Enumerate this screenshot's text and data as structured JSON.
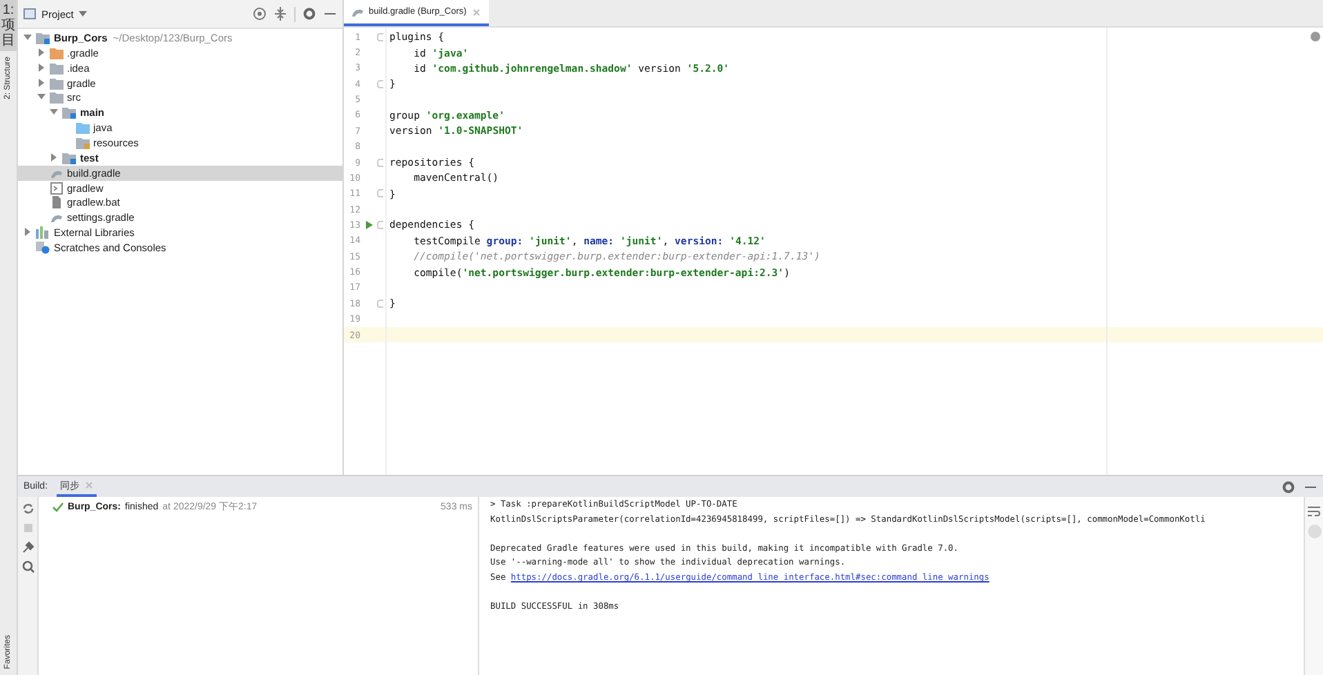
{
  "side_tabs": [
    {
      "label": "1: 项目",
      "kind": "stacked",
      "selected": true
    },
    {
      "label": "2: Structure",
      "kind": "rotated",
      "selected": false
    }
  ],
  "bottom_side_tabs": [
    {
      "label": "Favorites",
      "kind": "rotated",
      "selected": false
    }
  ],
  "project": {
    "title": "Project",
    "tree": [
      {
        "label": "Burp_Cors",
        "path": "~/Desktop/123/Burp_Cors",
        "kind": "module",
        "bold": true,
        "expanded": true,
        "selected": false,
        "children": [
          {
            "label": ".gradle",
            "kind": "folder-orange",
            "bold": false,
            "expanded": false,
            "selected": false
          },
          {
            "label": ".idea",
            "kind": "folder",
            "bold": false,
            "expanded": false,
            "selected": false
          },
          {
            "label": "gradle",
            "kind": "folder",
            "bold": false,
            "expanded": false,
            "selected": false
          },
          {
            "label": "src",
            "kind": "folder",
            "bold": false,
            "expanded": true,
            "selected": false,
            "children": [
              {
                "label": "main",
                "kind": "module-folder",
                "bold": true,
                "expanded": true,
                "selected": false,
                "children": [
                  {
                    "label": "java",
                    "kind": "source-folder",
                    "bold": false,
                    "selected": false
                  },
                  {
                    "label": "resources",
                    "kind": "resource-folder",
                    "bold": false,
                    "selected": false
                  }
                ]
              },
              {
                "label": "test",
                "kind": "module-folder",
                "bold": true,
                "expanded": false,
                "selected": false
              }
            ]
          },
          {
            "label": "build.gradle",
            "kind": "gradle-file",
            "bold": false,
            "selected": true
          },
          {
            "label": "gradlew",
            "kind": "script-file",
            "bold": false,
            "selected": false
          },
          {
            "label": "gradlew.bat",
            "kind": "bat-file",
            "bold": false,
            "selected": false
          },
          {
            "label": "settings.gradle",
            "kind": "gradle-file",
            "bold": false,
            "selected": false
          }
        ]
      },
      {
        "label": "External Libraries",
        "kind": "libraries",
        "bold": false,
        "expanded": false,
        "selected": false
      },
      {
        "label": "Scratches and Consoles",
        "kind": "scratches",
        "bold": false,
        "selected": false
      }
    ]
  },
  "editor": {
    "tabs": [
      {
        "label": "build.gradle (Burp_Cors)",
        "selected": true
      }
    ],
    "lines": [
      {
        "number": "1",
        "fold": true,
        "run": false,
        "current": false,
        "segments": [
          {
            "kind": "plain",
            "text": "plugins {"
          }
        ]
      },
      {
        "number": "2",
        "fold": false,
        "run": false,
        "current": false,
        "segments": [
          {
            "kind": "plain",
            "text": "    id "
          },
          {
            "kind": "string",
            "text": "'java'"
          }
        ]
      },
      {
        "number": "3",
        "fold": false,
        "run": false,
        "current": false,
        "segments": [
          {
            "kind": "plain",
            "text": "    id "
          },
          {
            "kind": "string",
            "text": "'com.github.johnrengelman.shadow'"
          },
          {
            "kind": "plain",
            "text": " version "
          },
          {
            "kind": "string",
            "text": "'5.2.0'"
          }
        ]
      },
      {
        "number": "4",
        "fold": true,
        "run": false,
        "current": false,
        "segments": [
          {
            "kind": "plain",
            "text": "}"
          }
        ]
      },
      {
        "number": "5",
        "fold": false,
        "run": false,
        "current": false
      },
      {
        "number": "6",
        "fold": false,
        "run": false,
        "current": false,
        "segments": [
          {
            "kind": "plain",
            "text": "group "
          },
          {
            "kind": "string",
            "text": "'org.example'"
          }
        ]
      },
      {
        "number": "7",
        "fold": false,
        "run": false,
        "current": false,
        "segments": [
          {
            "kind": "plain",
            "text": "version "
          },
          {
            "kind": "string",
            "text": "'1.0-SNAPSHOT'"
          }
        ]
      },
      {
        "number": "8",
        "fold": false,
        "run": false,
        "current": false
      },
      {
        "number": "9",
        "fold": true,
        "run": false,
        "current": false,
        "segments": [
          {
            "kind": "plain",
            "text": "repositories {"
          }
        ]
      },
      {
        "number": "10",
        "fold": false,
        "run": false,
        "current": false,
        "segments": [
          {
            "kind": "plain",
            "text": "    mavenCentral()"
          }
        ]
      },
      {
        "number": "11",
        "fold": true,
        "run": false,
        "current": false,
        "segments": [
          {
            "kind": "plain",
            "text": "}"
          }
        ]
      },
      {
        "number": "12",
        "fold": false,
        "run": false,
        "current": false
      },
      {
        "number": "13",
        "fold": true,
        "run": true,
        "current": false,
        "segments": [
          {
            "kind": "plain",
            "text": "dependencies {"
          }
        ]
      },
      {
        "number": "14",
        "fold": false,
        "run": false,
        "current": false,
        "segments": [
          {
            "kind": "plain",
            "text": "    testCompile "
          },
          {
            "kind": "named",
            "text": "group:"
          },
          {
            "kind": "string",
            "text": " 'junit'"
          },
          {
            "kind": "plain",
            "text": ", "
          },
          {
            "kind": "named",
            "text": "name:"
          },
          {
            "kind": "string",
            "text": " 'junit'"
          },
          {
            "kind": "plain",
            "text": ", "
          },
          {
            "kind": "named",
            "text": "version:"
          },
          {
            "kind": "string",
            "text": " '4.12'"
          }
        ]
      },
      {
        "number": "15",
        "fold": false,
        "run": false,
        "current": false,
        "segments": [
          {
            "kind": "comment",
            "text": "    //compile('net.portswigger.burp.extender:burp-extender-api:1.7.13')"
          }
        ]
      },
      {
        "number": "16",
        "fold": false,
        "run": false,
        "current": false,
        "segments": [
          {
            "kind": "plain",
            "text": "    compile("
          },
          {
            "kind": "string",
            "text": "'net.portswigger.burp.extender:burp-extender-api:2.3'"
          },
          {
            "kind": "plain",
            "text": ")"
          }
        ]
      },
      {
        "number": "17",
        "fold": false,
        "run": false,
        "current": false
      },
      {
        "number": "18",
        "fold": true,
        "run": false,
        "current": false,
        "segments": [
          {
            "kind": "plain",
            "text": "}"
          }
        ]
      },
      {
        "number": "19",
        "fold": false,
        "run": false,
        "current": false
      },
      {
        "number": "20",
        "fold": false,
        "run": false,
        "current": true
      }
    ]
  },
  "build": {
    "label": "Build:",
    "tabs": [
      {
        "label": "同步",
        "selected": true
      }
    ],
    "items": [
      {
        "succeeded": true,
        "name": "Burp_Cors:",
        "state": "finished",
        "time": "at 2022/9/29 下午2:17",
        "duration": "533 ms"
      }
    ],
    "console": [
      {
        "lines": [
          {
            "text": "> Task :prepareKotlinBuildScriptModel UP-TO-DATE"
          },
          {
            "text": "KotlinDslScriptsParameter(correlationId=4236945818499, scriptFiles=[]) => StandardKotlinDslScriptsModel(scripts=[], commonModel=CommonKotli"
          }
        ]
      },
      {
        "lines": [
          {
            "text": "Deprecated Gradle features were used in this build, making it incompatible with Gradle 7.0."
          },
          {
            "text": "Use '--warning-mode all' to show the individual deprecation warnings."
          },
          {
            "text": "See ",
            "link": "https://docs.gradle.org/6.1.1/userguide/command_line_interface.html#sec:command_line_warnings"
          }
        ]
      },
      {
        "lines": [
          {
            "text": "BUILD SUCCESSFUL in 308ms"
          }
        ]
      }
    ]
  }
}
